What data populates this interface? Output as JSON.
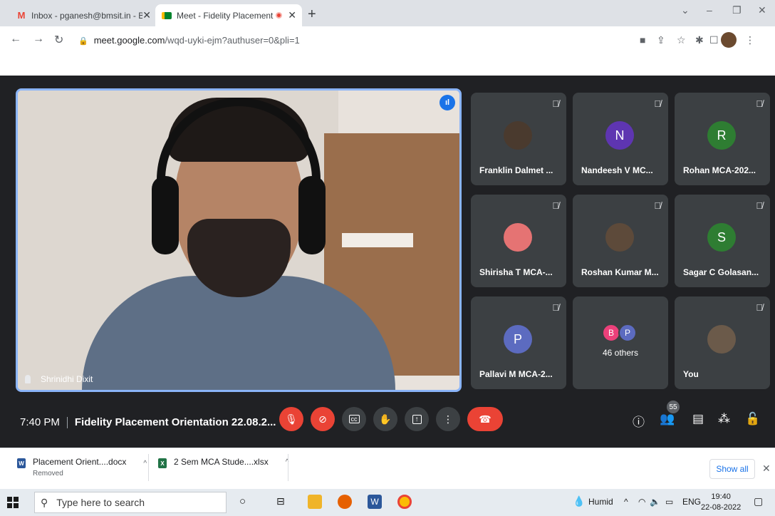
{
  "browser": {
    "tabs": [
      {
        "title": "Inbox - pganesh@bmsit.in - BMS",
        "icon": "gmail-icon"
      },
      {
        "title": "Meet - Fidelity Placement Or",
        "icon": "meet-icon"
      }
    ],
    "new_tab": "+",
    "window_controls": {
      "dropdown": "⌄",
      "minimize": "–",
      "restore": "❐",
      "close": "✕"
    },
    "url_host": "meet.google.com",
    "url_path": "/wqd-uyki-ejm?authuser=0&pli=1"
  },
  "meet": {
    "main_speaker": "Shrinidhi Dixit",
    "participants": [
      {
        "name": "Franklin Dalmet ...",
        "type": "photo",
        "color": "#4a3a2e"
      },
      {
        "name": "Nandeesh V MC...",
        "type": "initial",
        "initial": "N",
        "color": "#5e35b1"
      },
      {
        "name": "Rohan MCA-202...",
        "type": "initial",
        "initial": "R",
        "color": "#2e7d32"
      },
      {
        "name": "Shirisha T MCA-...",
        "type": "photo",
        "color": "#e57373"
      },
      {
        "name": "Roshan Kumar M...",
        "type": "photo",
        "color": "#5d4a3a"
      },
      {
        "name": "Sagar C Golasan...",
        "type": "initial",
        "initial": "S",
        "color": "#2e7d32"
      },
      {
        "name": "Pallavi M MCA-2...",
        "type": "initial",
        "initial": "P",
        "color": "#5c6bc0"
      },
      {
        "name": "46 others",
        "type": "others",
        "initials": [
          "B",
          "P"
        ],
        "colors": [
          "#ec407a",
          "#5c6bc0"
        ]
      },
      {
        "name": "You",
        "type": "photo",
        "color": "#6b5a4a"
      }
    ],
    "time": "7:40 PM",
    "meeting_title": "Fidelity Placement Orientation 22.08.2...",
    "participant_count": "55"
  },
  "downloads": [
    {
      "name": "Placement Orient....docx",
      "status": "Removed",
      "type": "word"
    },
    {
      "name": "2 Sem MCA Stude....xlsx",
      "status": "",
      "type": "excel"
    }
  ],
  "downloads_show_all": "Show all",
  "taskbar": {
    "search_placeholder": "Type here to search",
    "weather": "Humid",
    "lang": "ENG",
    "time": "19:40",
    "date": "22-08-2022"
  }
}
